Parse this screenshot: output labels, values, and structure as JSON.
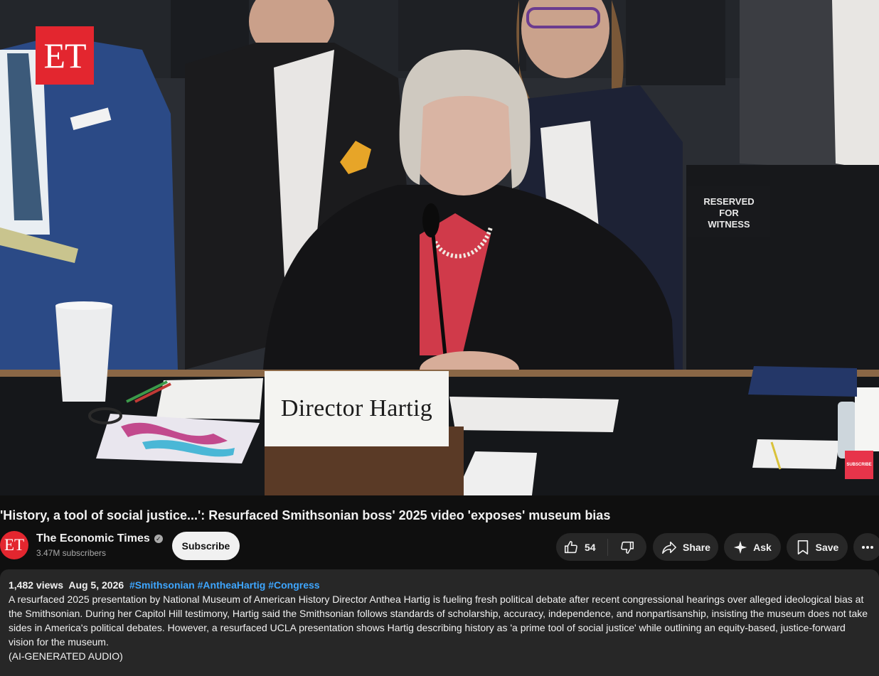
{
  "video": {
    "logo_text": "ET",
    "nameplate_text": "Director Hartig",
    "reserved_sign": [
      "RESERVED",
      "FOR",
      "WITNESS"
    ],
    "overlay_subscribe": "SUBSCRIBE"
  },
  "title": "'History, a tool of social justice...': Resurfaced Smithsonian boss' 2025 video 'exposes' museum bias",
  "channel": {
    "avatar_text": "ET",
    "name": "The Economic Times",
    "subscribers": "3.47M subscribers",
    "subscribe_label": "Subscribe"
  },
  "actions": {
    "like_count": "54",
    "share_label": "Share",
    "ask_label": "Ask",
    "save_label": "Save"
  },
  "description": {
    "views": "1,482 views",
    "date": "Aug 5, 2026",
    "hashtags": [
      "#Smithsonian",
      "#AntheaHartig",
      "#Congress"
    ],
    "text": "A resurfaced 2025 presentation by National Museum of American History Director Anthea Hartig is fueling fresh political debate after recent congressional hearings over alleged ideological bias at the Smithsonian. During her Capitol Hill testimony, Hartig said the Smithsonian follows standards of scholarship, accuracy, independence, and nonpartisanship, insisting the museum does not take sides in America's political debates. However, a resurfaced UCLA presentation shows Hartig describing history as 'a prime tool of social justice' while outlining an equity-based, justice-forward vision for the museum.",
    "ai_note": "(AI-GENERATED AUDIO)"
  }
}
